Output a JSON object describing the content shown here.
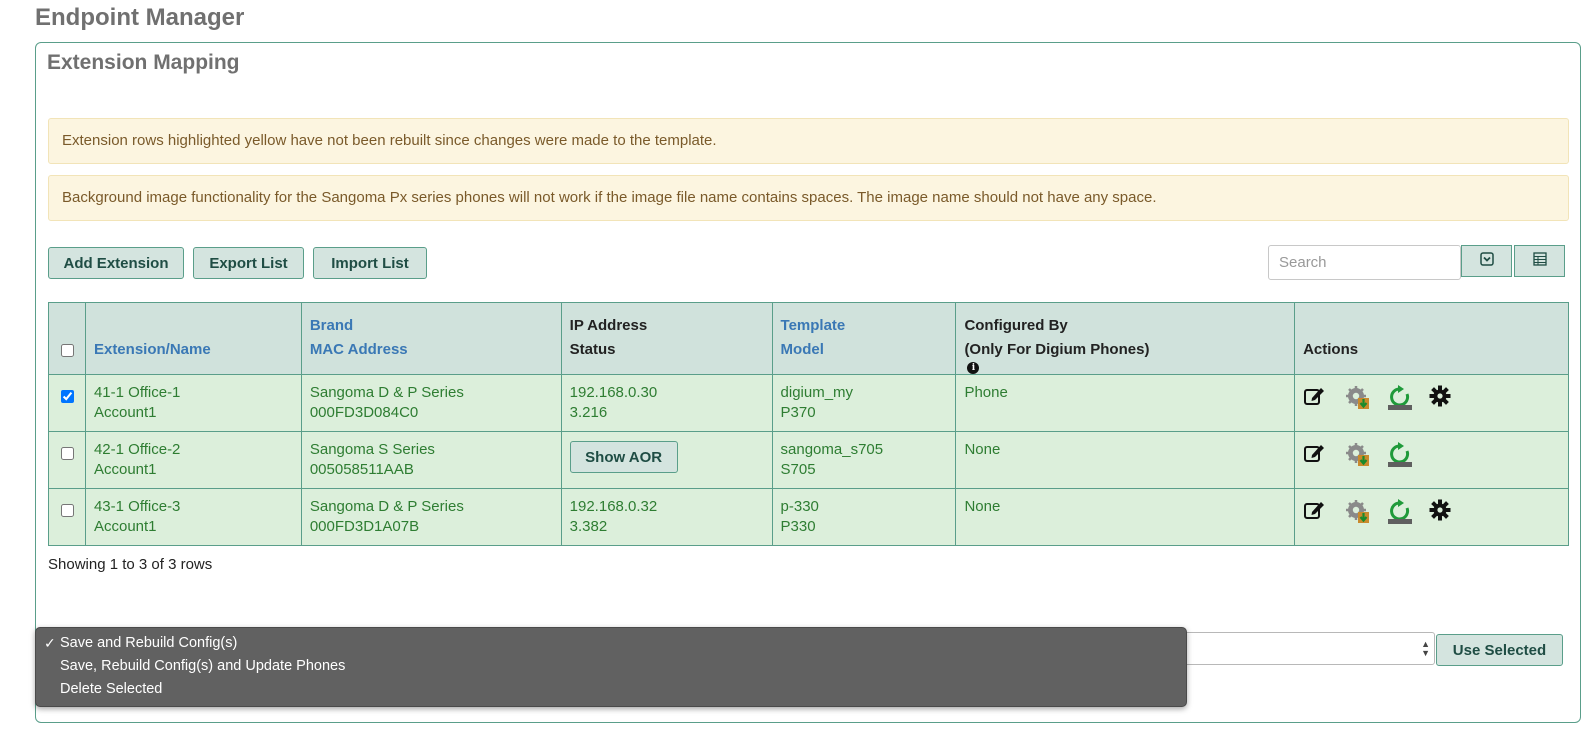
{
  "page": {
    "title": "Endpoint Manager"
  },
  "panel": {
    "title": "Extension Mapping"
  },
  "alerts": [
    "Extension rows highlighted yellow have not been rebuilt since changes were made to the template.",
    "Background image functionality for the Sangoma Px series phones will not work if the image file name contains spaces. The image name should not have any space."
  ],
  "toolbar": {
    "add_label": "Add Extension",
    "export_label": "Export List",
    "import_label": "Import List",
    "search_placeholder": "Search"
  },
  "table": {
    "headers": {
      "extension": "Extension/Name",
      "brand": "Brand",
      "mac": "MAC Address",
      "ip": "IP Address",
      "status": "Status",
      "template": "Template",
      "model": "Model",
      "configured": "Configured By",
      "configured_sub": "(Only For Digium Phones)",
      "actions": "Actions"
    },
    "rows": [
      {
        "checked": true,
        "ext": "41-1 Office-1",
        "account": "Account1",
        "brand": "Sangoma D & P Series",
        "mac": "000FD3D084C0",
        "ip": "192.168.0.30",
        "status": "3.216",
        "template": "digium_my",
        "model": "P370",
        "configured": "Phone",
        "has_settings": true
      },
      {
        "checked": false,
        "ext": "42-1 Office-2",
        "account": "Account1",
        "brand": "Sangoma S Series",
        "mac": "005058511AAB",
        "aor_label": "Show AOR",
        "template": "sangoma_s705",
        "model": "S705",
        "configured": "None",
        "has_settings": false
      },
      {
        "checked": false,
        "ext": "43-1 Office-3",
        "account": "Account1",
        "brand": "Sangoma D & P Series",
        "mac": "000FD3D1A07B",
        "ip": "192.168.0.32",
        "status": "3.382",
        "template": "p-330",
        "model": "P330",
        "configured": "None",
        "has_settings": true
      }
    ],
    "footer": "Showing 1 to 3 of 3 rows"
  },
  "bulk_action": {
    "options": [
      "Save and Rebuild Config(s)",
      "Save, Rebuild Config(s) and Update Phones",
      "Delete Selected"
    ],
    "selected": "Save and Rebuild Config(s)",
    "use_label": "Use Selected"
  },
  "colors": {
    "accent": "#5a9e8a",
    "row_bg": "#dcefdb",
    "header_bg": "#d0e2dc",
    "link": "#3a78b5",
    "row_text": "#2e7d32",
    "alert_bg": "#fcf5e0"
  },
  "icons": [
    "edit-icon",
    "download-config-icon",
    "reboot-icon",
    "settings-gear-icon",
    "collapse-icon",
    "columns-icon",
    "info-icon",
    "check-icon"
  ]
}
